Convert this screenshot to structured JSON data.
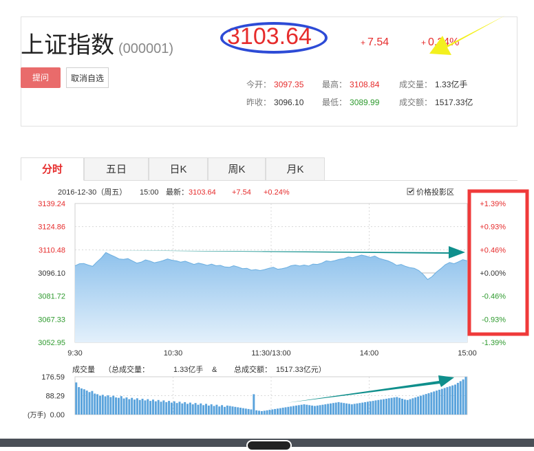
{
  "stock": {
    "name": "上证指数",
    "code": "(000001)",
    "price": "3103.64",
    "change": "7.54",
    "change_pct": "0.24%",
    "sign": "+"
  },
  "buttons": {
    "remind": "提问",
    "unfavorite": "取消自选"
  },
  "stats": {
    "open_label": "今开：",
    "open": "3097.35",
    "high_label": "最高：",
    "high": "3108.84",
    "volume_label": "成交量：",
    "volume": "1.33亿手",
    "prev_close_label": "昨收：",
    "prev_close": "3096.10",
    "low_label": "最低：",
    "low": "3089.99",
    "amount_label": "成交额：",
    "amount": "1517.33亿"
  },
  "tabs": [
    "分时",
    "五日",
    "日K",
    "周K",
    "月K"
  ],
  "chart_info": {
    "date": "2016-12-30（周五）",
    "time": "15:00",
    "latest_label": "最新：",
    "latest": "3103.64",
    "change": "+7.54",
    "change_pct": "+0.24%",
    "checkbox_label": "价格投影区"
  },
  "volume_info": {
    "label": "成交量",
    "total_vol_label": "（总成交量：",
    "total_vol": "1.33亿手",
    "amp": "&",
    "total_amt_label": "总成交额：",
    "total_amt": "1517.33亿元）"
  },
  "colors": {
    "up": "#e62c2c",
    "down": "#2e9a2e",
    "area": "#9ccbee",
    "line": "#6aaee0",
    "volume": "#5aa3dc",
    "annotation_box": "#ef3a3a",
    "annotation_arrow": "#0f8f8c",
    "ellipse": "#2d4bd6",
    "yellow_arrow": "#f3f01e"
  },
  "chart_data": [
    {
      "type": "area",
      "x_ticks": [
        "9:30",
        "10:30",
        "11:30/13:00",
        "14:00",
        "15:00"
      ],
      "y_ticks_left": [
        "3139.24",
        "3124.86",
        "3110.48",
        "3096.10",
        "3081.72",
        "3067.33",
        "3052.95"
      ],
      "y_ticks_right": [
        "+1.39%",
        "+0.93%",
        "+0.46%",
        "+0.00%",
        "-0.46%",
        "-0.93%",
        "-1.39%"
      ],
      "ylim": [
        3052.95,
        3139.24
      ],
      "prev_close": 3096.1,
      "series": [
        {
          "values": [
            3100.5,
            3101.8,
            3102.0,
            3101.0,
            3100.2,
            3103.0,
            3105.5,
            3108.8,
            3107.4,
            3106.2,
            3104.8,
            3104.5,
            3105.0,
            3103.6,
            3102.2,
            3102.8,
            3104.2,
            3103.5,
            3102.4,
            3103.0,
            3103.8,
            3104.8,
            3104.0,
            3103.6,
            3102.8,
            3103.4,
            3102.4,
            3101.4,
            3102.2,
            3101.6,
            3100.8,
            3101.6,
            3100.6,
            3100.8,
            3099.8,
            3099.6,
            3100.6,
            3099.8,
            3098.8,
            3099.0,
            3097.8,
            3098.2,
            3097.6,
            3098.2,
            3099.0,
            3099.6,
            3098.4,
            3098.8,
            3099.4,
            3100.6,
            3101.0,
            3100.4,
            3101.0,
            3100.4,
            3101.6,
            3101.4,
            3102.2,
            3103.6,
            3103.2,
            3103.8,
            3104.6,
            3105.0,
            3106.0,
            3105.6,
            3106.4,
            3107.2,
            3106.6,
            3105.8,
            3106.6,
            3105.2,
            3104.4,
            3103.6,
            3102.4,
            3100.8,
            3101.4,
            3100.2,
            3099.4,
            3099.0,
            3097.6,
            3095.2,
            3092.0,
            3093.8,
            3096.6,
            3098.8,
            3101.2,
            3102.6,
            3101.8,
            3103.0,
            3104.4,
            3103.64
          ]
        }
      ]
    },
    {
      "type": "bar",
      "y_ticks": [
        "176.59",
        "88.29",
        "0.00"
      ],
      "y_unit": "(万手)",
      "ylim": [
        0,
        176.59
      ],
      "values": [
        150,
        128,
        122,
        118,
        112,
        105,
        110,
        98,
        95,
        88,
        92,
        85,
        90,
        82,
        88,
        80,
        78,
        86,
        75,
        80,
        72,
        78,
        70,
        76,
        68,
        74,
        66,
        72,
        64,
        70,
        62,
        68,
        60,
        66,
        58,
        64,
        56,
        62,
        54,
        60,
        52,
        58,
        50,
        56,
        48,
        54,
        46,
        52,
        44,
        50,
        42,
        48,
        40,
        46,
        38,
        44,
        36,
        42,
        40,
        38,
        36,
        34,
        32,
        30,
        28,
        26,
        24,
        95,
        20,
        18,
        16,
        18,
        20,
        22,
        24,
        26,
        28,
        30,
        32,
        34,
        36,
        38,
        40,
        42,
        44,
        46,
        48,
        46,
        44,
        42,
        40,
        42,
        44,
        46,
        48,
        50,
        52,
        54,
        56,
        58,
        56,
        54,
        52,
        50,
        48,
        50,
        52,
        54,
        56,
        58,
        60,
        62,
        64,
        66,
        68,
        70,
        72,
        74,
        76,
        78,
        80,
        82,
        78,
        74,
        70,
        68,
        72,
        76,
        80,
        84,
        88,
        92,
        96,
        100,
        104,
        108,
        112,
        116,
        120,
        124,
        128,
        132,
        136,
        140,
        148,
        156,
        164,
        176
      ]
    }
  ]
}
